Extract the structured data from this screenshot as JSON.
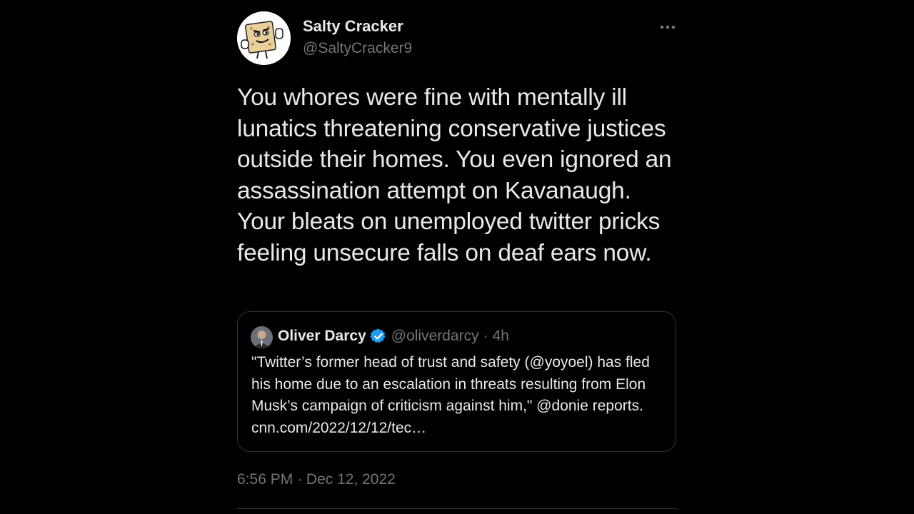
{
  "author": {
    "name": "Salty Cracker",
    "handle": "@SaltyCracker9"
  },
  "tweet": {
    "text": "You whores were fine with mentally ill lunatics threatening conservative justices outside their homes. You even ignored an assassination attempt on Kavanaugh. Your bleats on unemployed twitter pricks feeling unsecure falls on deaf ears now.",
    "time": "6:56 PM",
    "separator": "·",
    "date": "Dec 12, 2022"
  },
  "quote": {
    "name": "Oliver Darcy",
    "handle": "@oliverdarcy",
    "separator": "·",
    "age": "4h",
    "text": "\"Twitter’s former head of trust and safety (@yoyoel) has fled his home due to an escalation in threats resulting from Elon Musk’s campaign of criticism against him,\" @donie reports. cnn.com/2022/12/12/tec…"
  },
  "icons": {
    "more": "more-horizontal-icon",
    "verified": "verified-badge-icon"
  },
  "colors": {
    "background": "#000000",
    "text_primary": "#e7e9ea",
    "text_secondary": "#71767b",
    "border": "#2f3336",
    "verified": "#1d9bf0"
  }
}
